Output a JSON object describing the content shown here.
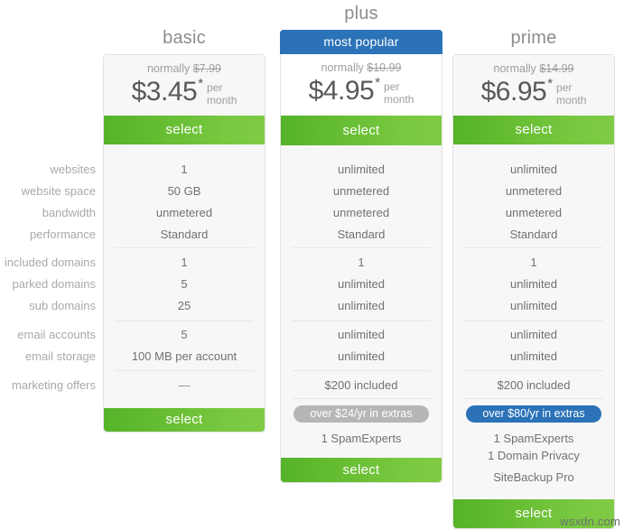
{
  "colors": {
    "accent_green_dark": "#55b32a",
    "accent_green_light": "#80cb45",
    "accent_blue": "#2b72b8",
    "pill_gray": "#b4b6b8",
    "card_bg": "#f7f7f7",
    "card_border": "#e2e3e4",
    "text_muted": "#a7aaac",
    "text_body": "#6f7173"
  },
  "plans": {
    "basic": {
      "title": "basic",
      "normally_prefix": "normally",
      "old_price": "$7.99",
      "price": "$3.45",
      "star": "*",
      "per": "per",
      "month": "month",
      "select_top": "select",
      "select_bottom": "select"
    },
    "plus": {
      "title": "plus",
      "badge": "most popular",
      "normally_prefix": "normally",
      "old_price": "$10.99",
      "price": "$4.95",
      "star": "*",
      "per": "per",
      "month": "month",
      "select_top": "select",
      "select_bottom": "select",
      "extras_pill": "over $24/yr in extras"
    },
    "prime": {
      "title": "prime",
      "normally_prefix": "normally",
      "old_price": "$14.99",
      "price": "$6.95",
      "star": "*",
      "per": "per",
      "month": "month",
      "select_top": "select",
      "select_bottom": "select",
      "extras_pill": "over $80/yr in extras"
    }
  },
  "feature_labels": [
    "websites",
    "website space",
    "bandwidth",
    "performance",
    "included domains",
    "parked domains",
    "sub domains",
    "email accounts",
    "email storage",
    "marketing offers"
  ],
  "features": {
    "basic": {
      "websites": "1",
      "website_space": "50 GB",
      "bandwidth": "unmetered",
      "performance": "Standard",
      "included_domains": "1",
      "parked_domains": "5",
      "sub_domains": "25",
      "email_accounts": "5",
      "email_storage": "100 MB per account",
      "marketing_offers": "—"
    },
    "plus": {
      "websites": "unlimited",
      "website_space": "unmetered",
      "bandwidth": "unmetered",
      "performance": "Standard",
      "included_domains": "1",
      "parked_domains": "unlimited",
      "sub_domains": "unlimited",
      "email_accounts": "unlimited",
      "email_storage": "unlimited",
      "marketing_offers": "$200 included",
      "extras": [
        "1 SpamExperts"
      ]
    },
    "prime": {
      "websites": "unlimited",
      "website_space": "unmetered",
      "bandwidth": "unmetered",
      "performance": "Standard",
      "included_domains": "1",
      "parked_domains": "unlimited",
      "sub_domains": "unlimited",
      "email_accounts": "unlimited",
      "email_storage": "unlimited",
      "marketing_offers": "$200 included",
      "extras": [
        "1 SpamExperts",
        "1 Domain Privacy",
        "SiteBackup Pro"
      ]
    }
  },
  "watermark": "wsxdn.com"
}
